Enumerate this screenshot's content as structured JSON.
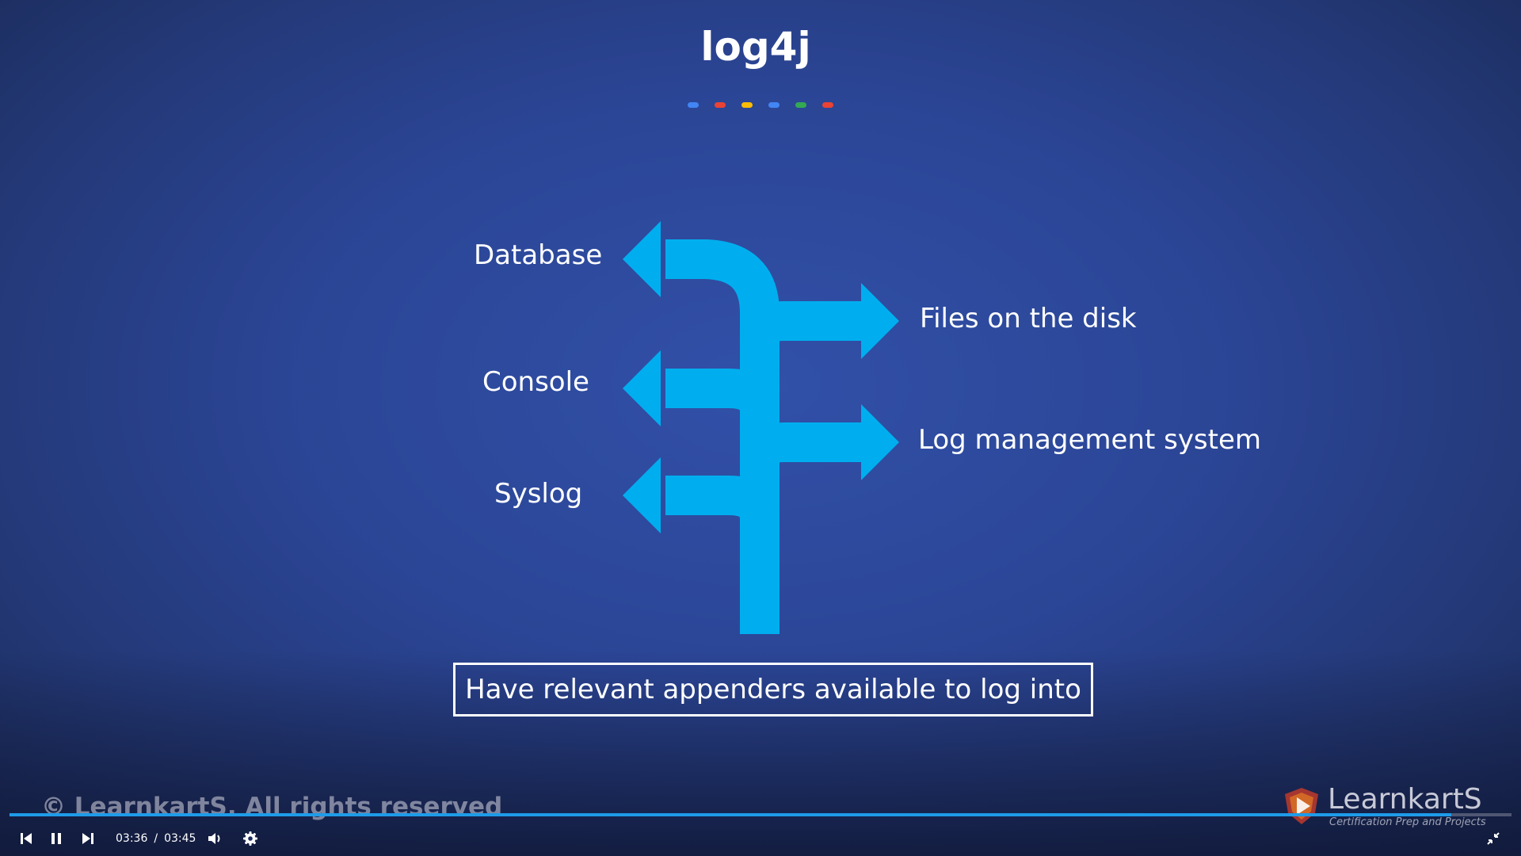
{
  "slide": {
    "title": "log4j",
    "dot_colors": [
      "#4285f4",
      "#ea4335",
      "#fbbc05",
      "#4285f4",
      "#34a853",
      "#ea4335"
    ],
    "arrow_color": "#00aeef",
    "appenders_left": [
      "Database",
      "Console",
      "Syslog"
    ],
    "appenders_right": [
      "Files on the disk",
      "Log management system"
    ],
    "caption": "Have relevant appenders available to log into"
  },
  "overlay": {
    "copyright": "© LearnkartS. All rights reserved",
    "brand_name": "LearnkartS",
    "brand_tagline": "Certification Prep and Projects"
  },
  "player": {
    "current_time": "03:36",
    "separator": "/",
    "duration": "03:45",
    "progress_fraction": 0.96,
    "progress_color": "#1e9be8",
    "icons": [
      "skip-back-icon",
      "pause-icon",
      "skip-forward-icon",
      "volume-icon",
      "settings-icon",
      "exit-fullscreen-icon"
    ]
  }
}
